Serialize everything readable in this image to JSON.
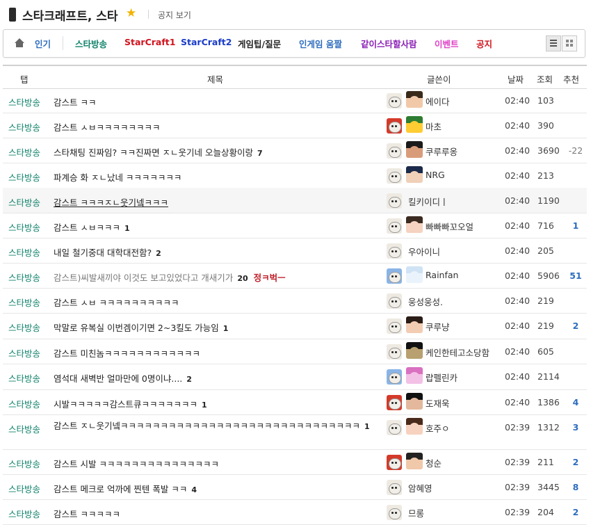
{
  "header": {
    "board_title": "스타크래프트, 스타",
    "star_icon": "★",
    "notice_link": "공지 보기"
  },
  "tabs": [
    {
      "label": "인기",
      "color": "#2d6dbf"
    },
    {
      "label": "스타방송",
      "color": "#10826a"
    },
    {
      "label": "StarCraft1",
      "color": "#d0141e"
    },
    {
      "label": "StarCraft2",
      "color": "#1a3cc8"
    },
    {
      "label": "게임팁/질문",
      "color": "#222222"
    },
    {
      "label": "인게임 움짤",
      "color": "#2d6dbf"
    },
    {
      "label": "같이스타할사람",
      "color": "#8a1fb5"
    },
    {
      "label": "이벤트",
      "color": "#e040c8"
    },
    {
      "label": "공지",
      "color": "#d0141e"
    }
  ],
  "view_toggle": {
    "list_icon": "list-view-icon",
    "grid_icon": "grid-view-icon",
    "active": "list"
  },
  "columns": {
    "tab": "탭",
    "title": "제목",
    "writer": "글쓴이",
    "date": "날짜",
    "views": "조회",
    "recommend": "추천"
  },
  "rows": [
    {
      "tab": "스타방송",
      "title": "감스트 ㅋㅋ",
      "comments": "",
      "tag": "",
      "writer": "에이다",
      "date": "02:40",
      "views": "103",
      "rec": ""
    },
    {
      "tab": "스타방송",
      "title": "감스트 ㅅㅂㅋㅋㅋㅋㅋㅋㅋㅋ",
      "comments": "",
      "tag": "",
      "writer": "마초",
      "date": "02:40",
      "views": "390",
      "rec": ""
    },
    {
      "tab": "스타방송",
      "title": "스타채팅 진짜임? ㅋㅋ진짜면 ㅈㄴ웃기네 오늘상황이랑",
      "comments": "7",
      "tag": "",
      "writer": "쿠루루옹",
      "date": "02:40",
      "views": "3690",
      "rec": "-22"
    },
    {
      "tab": "스타방송",
      "title": "파계승 화 ㅈㄴ났네 ㅋㅋㅋㅋㅋㅋㅋ",
      "comments": "",
      "tag": "",
      "writer": "NRG",
      "date": "02:40",
      "views": "213",
      "rec": ""
    },
    {
      "tab": "스타방송",
      "title": "감스트 ㅋㅋㅋㅈㄴ웃기넼ㅋㅋㅋ",
      "comments": "",
      "tag": "",
      "writer": "킬키이디ㅣ",
      "date": "02:40",
      "views": "1190",
      "rec": ""
    },
    {
      "tab": "스타방송",
      "title": "감스트 ㅅㅂㅋㅋㅋ",
      "comments": "1",
      "tag": "",
      "writer": "빠빠빠꼬오얼",
      "date": "02:40",
      "views": "716",
      "rec": "1"
    },
    {
      "tab": "스타방송",
      "title": "내일 철기중대 대학대전함?",
      "comments": "2",
      "tag": "",
      "writer": "우아이니",
      "date": "02:40",
      "views": "205",
      "rec": ""
    },
    {
      "tab": "스타방송",
      "title": "감스트)씨발새끼야 이것도 보고있었다고 개새기가",
      "comments": "20",
      "tag": "정ㅋ벅ㅡ",
      "writer": "Rainfan",
      "date": "02:40",
      "views": "5906",
      "rec": "51"
    },
    {
      "tab": "스타방송",
      "title": "감스트 ㅅㅂ ㅋㅋㅋㅋㅋㅋㅋㅋㅋㅋ",
      "comments": "",
      "tag": "",
      "writer": "웅성웅성.",
      "date": "02:40",
      "views": "219",
      "rec": ""
    },
    {
      "tab": "스타방송",
      "title": "막말로 유복실 이번겜이기면 2~3킬도 가능임",
      "comments": "1",
      "tag": "",
      "writer": "쿠루냥",
      "date": "02:40",
      "views": "219",
      "rec": "2"
    },
    {
      "tab": "스타방송",
      "title": "감스트 미친놈ㅋㅋㅋㅋㅋㅋㅋㅋㅋㅋㅋㅋ",
      "comments": "",
      "tag": "",
      "writer": "케인한테고소당함",
      "date": "02:40",
      "views": "605",
      "rec": ""
    },
    {
      "tab": "스타방송",
      "title": "염석대 새벽반 얼마만에 0명이냐....",
      "comments": "2",
      "tag": "",
      "writer": "랍펠린카",
      "date": "02:40",
      "views": "2114",
      "rec": ""
    },
    {
      "tab": "스타방송",
      "title": "시발ㅋㅋㅋㅋㅋ감스트큐ㅋㅋㅋㅋㅋㅋㅋ",
      "comments": "1",
      "tag": "",
      "writer": "도재욱",
      "date": "02:40",
      "views": "1386",
      "rec": "4"
    },
    {
      "tab": "스타방송",
      "title": "감스트 ㅈㄴ웃기넼ㅋㅋㅋㅋㅋㅋㅋㅋㅋㅋㅋㅋㅋㅋㅋㅋㅋㅋㅋㅋㅋㅋㅋㅋㅋㅋㅋㅋㅋㅋ",
      "comments": "1",
      "tag": "",
      "writer": "호주ㅇ",
      "date": "02:39",
      "views": "1312",
      "rec": "3"
    },
    {
      "tab": "스타방송",
      "title": "감스트 시발 ㅋㅋㅋㅋㅋㅋㅋㅋㅋㅋㅋㅋㅋㅋㅋ",
      "comments": "",
      "tag": "",
      "writer": "청순",
      "date": "02:39",
      "views": "211",
      "rec": "2"
    },
    {
      "tab": "스타방송",
      "title": "감스트 메크로 억까에 찐텐 폭발 ㅋㅋ",
      "comments": "4",
      "tag": "",
      "writer": "암혜영",
      "date": "02:39",
      "views": "3445",
      "rec": "8"
    },
    {
      "tab": "스타방송",
      "title": "감스트 ㅋㅋㅋㅋㅋ",
      "comments": "",
      "tag": "",
      "writer": "므롱",
      "date": "02:39",
      "views": "204",
      "rec": "2"
    }
  ]
}
